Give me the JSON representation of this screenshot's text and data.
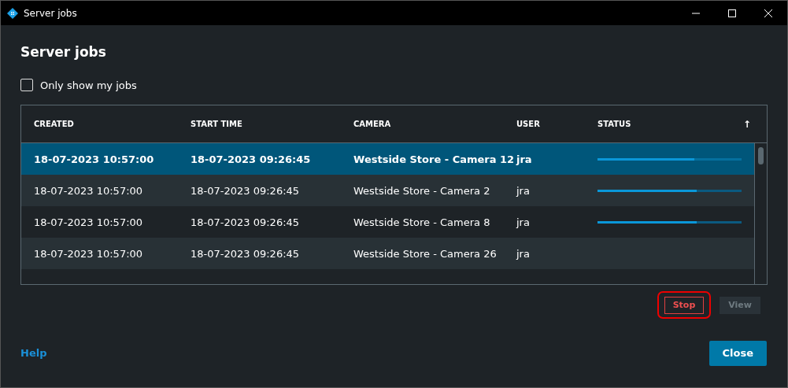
{
  "window": {
    "title": "Server jobs"
  },
  "heading": "Server jobs",
  "filter": {
    "label": "Only show my jobs",
    "checked": false
  },
  "table": {
    "columns": [
      "CREATED",
      "START TIME",
      "CAMERA",
      "USER",
      "STATUS"
    ],
    "sort_icon": "↑",
    "rows": [
      {
        "created": "18-07-2023 10:57:00",
        "start_time": "18-07-2023 09:26:45",
        "camera": "Westside Store - Camera 12",
        "user": "jra",
        "selected": true,
        "level": 0.67
      },
      {
        "created": "18-07-2023 10:57:00",
        "start_time": "18-07-2023 09:26:45",
        "camera": "Westside Store - Camera 2",
        "user": "jra",
        "selected": false,
        "level": 0.69
      },
      {
        "created": "18-07-2023 10:57:00",
        "start_time": "18-07-2023 09:26:45",
        "camera": "Westside Store - Camera 8",
        "user": "jra",
        "selected": false,
        "level": 0.69
      },
      {
        "created": "18-07-2023 10:57:00",
        "start_time": "18-07-2023 09:26:45",
        "camera": "Westside Store - Camera 26",
        "user": "jra",
        "selected": false
      }
    ]
  },
  "buttons": [
    {
      "label": "Stop",
      "kind": "danger",
      "highlighted": true,
      "disabled": false
    },
    {
      "label": "View",
      "kind": "plain",
      "highlighted": false,
      "disabled": true
    }
  ],
  "footer": {
    "help": "Help",
    "close": "Close"
  }
}
